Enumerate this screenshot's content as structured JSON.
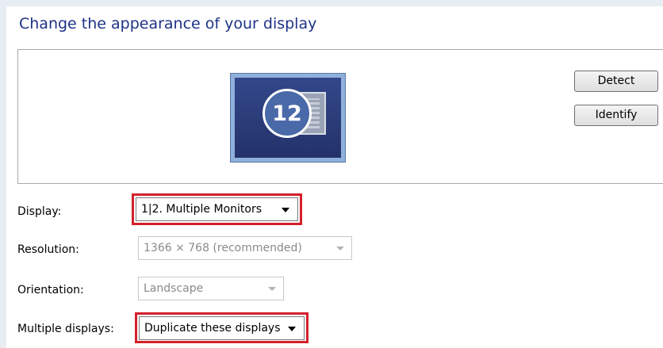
{
  "page": {
    "title": "Change the appearance of your display"
  },
  "preview": {
    "monitor_label": "12",
    "detect_label": "Detect",
    "identify_label": "Identify"
  },
  "settings": {
    "display": {
      "label": "Display:",
      "value": "1|2. Multiple Monitors"
    },
    "resolution": {
      "label": "Resolution:",
      "value": "1366 × 768 (recommended)"
    },
    "orientation": {
      "label": "Orientation:",
      "value": "Landscape"
    },
    "multiple_displays": {
      "label": "Multiple displays:",
      "value": "Duplicate these displays"
    }
  },
  "colors": {
    "title": "#1e3287",
    "highlight": "#d4202a",
    "monitor_frame": "#8fb0db"
  }
}
